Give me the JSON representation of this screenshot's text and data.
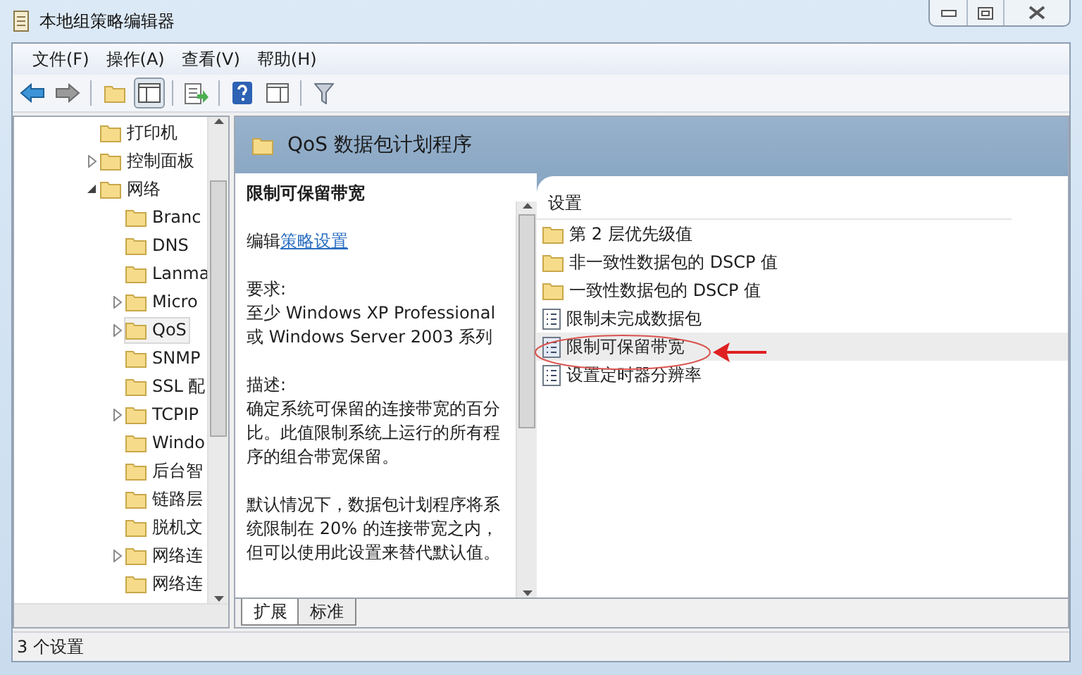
{
  "window": {
    "title": "本地组策略编辑器"
  },
  "menu": [
    "文件(F)",
    "操作(A)",
    "查看(V)",
    "帮助(H)"
  ],
  "tree": [
    {
      "label": "打印机",
      "expandable": false,
      "selected": false
    },
    {
      "label": "控制面板",
      "expandable": true,
      "expanded": false,
      "selected": false
    },
    {
      "label": "网络",
      "expandable": true,
      "expanded": true,
      "selected": false,
      "children": [
        {
          "label": "Branc",
          "expandable": false,
          "selected": false
        },
        {
          "label": "DNS",
          "expandable": false,
          "selected": false
        },
        {
          "label": "Lanma",
          "expandable": false,
          "selected": false
        },
        {
          "label": "Micro",
          "expandable": true,
          "expanded": false,
          "selected": false
        },
        {
          "label": "QoS",
          "expandable": true,
          "expanded": false,
          "selected": true
        },
        {
          "label": "SNMP",
          "expandable": false,
          "selected": false
        },
        {
          "label": "SSL 配",
          "expandable": false,
          "selected": false
        },
        {
          "label": "TCPIP",
          "expandable": true,
          "expanded": false,
          "selected": false
        },
        {
          "label": "Windo",
          "expandable": false,
          "selected": false
        },
        {
          "label": "后台智",
          "expandable": false,
          "selected": false
        },
        {
          "label": "链路层",
          "expandable": false,
          "selected": false
        },
        {
          "label": "脱机文",
          "expandable": false,
          "selected": false
        },
        {
          "label": "网络连",
          "expandable": true,
          "expanded": false,
          "selected": false
        },
        {
          "label": "网络连",
          "expandable": false,
          "selected": false
        }
      ]
    }
  ],
  "header": {
    "title": "QoS 数据包计划程序"
  },
  "description": {
    "title": "限制可保留带宽",
    "edit_prefix": "编辑",
    "edit_link": "策略设置",
    "requirements_label": "要求:",
    "requirements": "至少 Windows XP Professional 或 Windows Server 2003 系列",
    "description_label": "描述:",
    "paragraphs": [
      "确定系统可保留的连接带宽的百分比。此值限制系统上运行的所有程序的组合带宽保留。",
      "默认情况下，数据包计划程序将系统限制在 20% 的连接带宽之内，但可以使用此设置来替代默认值。"
    ]
  },
  "settings": {
    "column": "设置",
    "items": [
      {
        "label": "第 2 层优先级值",
        "kind": "folder",
        "selected": false
      },
      {
        "label": "非一致性数据包的 DSCP 值",
        "kind": "folder",
        "selected": false
      },
      {
        "label": "一致性数据包的 DSCP 值",
        "kind": "folder",
        "selected": false
      },
      {
        "label": "限制未完成数据包",
        "kind": "policy",
        "selected": false
      },
      {
        "label": "限制可保留带宽",
        "kind": "policy",
        "selected": true
      },
      {
        "label": "设置定时器分辨率",
        "kind": "policy",
        "selected": false
      }
    ]
  },
  "tabs": [
    {
      "label": "扩展",
      "selected": true
    },
    {
      "label": "标准",
      "selected": false
    }
  ],
  "status_bar": "3 个设置"
}
